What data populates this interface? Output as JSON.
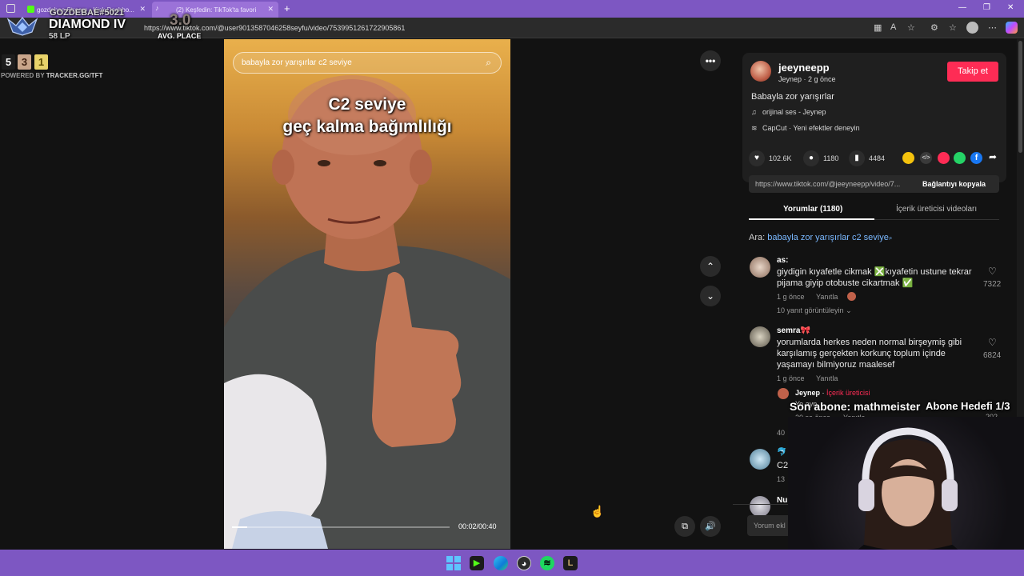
{
  "browser": {
    "tabs": [
      {
        "label": "gozdebae Stream - Kick Dashbo..."
      },
      {
        "label": "(2) Keşfedin: TikTok'ta favori"
      }
    ],
    "new_tab": "+",
    "url": "https://www.tiktok.com/@user9013587046258seyfu/video/7539951261722905861"
  },
  "overlay": {
    "account": "GOZDEBAE#5021",
    "rank": "DIAMOND IV",
    "lp": "58 LP",
    "avg_value": "3.0",
    "avg_label": "AVG. PLACE",
    "placements": [
      "5",
      "3",
      "1"
    ],
    "powered_prefix": "POWERED BY ",
    "powered_brand": "TRACKER.GG/TFT",
    "last_sub": "Son abone: mathmeister",
    "sub_goal": "Abone Hedefi 1/3"
  },
  "video": {
    "search_text": "babayla zor yarışırlar c2 seviye",
    "caption_line1": "C2 seviye",
    "caption_line2": "geç kalma bağımlılığı",
    "time": "00:02/00:40",
    "progress": 0.07
  },
  "post": {
    "username": "jeeyneepp",
    "subline": "Jeynep · 2 g önce",
    "follow_label": "Takip et",
    "description": "Babayla zor yarışırlar",
    "sound": "orijinal ses - Jeynep",
    "capcut": "CapCut · Yeni efektler deneyin",
    "likes": "102.6K",
    "comments": "1180",
    "saves": "4484",
    "link": "https://www.tiktok.com/@jeeyneepp/video/7...",
    "copy_label": "Bağlantıyı kopyala",
    "tab_comments": "Yorumlar (1180)",
    "tab_creator": "İçerik üreticisi videoları",
    "search_prefix": "Ara: ",
    "search_query": "babayla zor yarışırlar c2 seviye",
    "add_comment_placeholder": "Yorum ekl"
  },
  "comments": [
    {
      "name": "as:",
      "text": "giydigin kıyafetle cikmak ❎kıyafetin ustune tekrar pijama giyip otobuste cikartmak ✅",
      "time": "1 g önce",
      "reply": "Yanıtla",
      "likes": "7322",
      "view_replies": "10 yanıt görüntüleyin"
    },
    {
      "name": "semra🎀",
      "text": "yorumlarda herkes neden normal birşeymiş gibi karşılamış gerçekten korkunç toplum içinde yaşamayı bilmiyoruz maalesef",
      "time": "1 g önce",
      "reply": "Yanıtla",
      "likes": "6824"
    }
  ],
  "creator_reply": {
    "name": "Jeynep",
    "badge": "İçerik üreticisi",
    "text": "Yo ayn",
    "time": "20 sa önce",
    "reply": "Yanıtla",
    "likes": "202",
    "more": "40"
  },
  "third_comment": {
    "name": "🐬",
    "text": "C2",
    "meta": "13"
  },
  "fourth_comment": {
    "name": "Nu"
  },
  "colors": {
    "tiktok_red": "#fe2c55",
    "chrome_purple": "#7d57c2"
  }
}
